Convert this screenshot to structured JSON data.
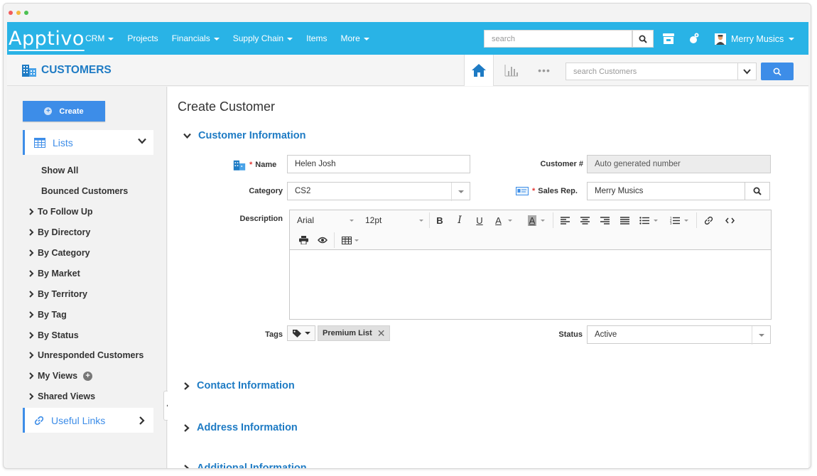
{
  "nav": {
    "logo": "Apptivo",
    "menu": [
      {
        "label": "CRM",
        "dropdown": true
      },
      {
        "label": "Projects",
        "dropdown": false
      },
      {
        "label": "Financials",
        "dropdown": true
      },
      {
        "label": "Supply Chain",
        "dropdown": true
      },
      {
        "label": "Items",
        "dropdown": false
      },
      {
        "label": "More",
        "dropdown": true
      }
    ],
    "search_placeholder": "search",
    "user_name": "Merry Musics",
    "icons": [
      "search-icon",
      "store-icon",
      "user-gear-icon",
      "avatar-icon"
    ]
  },
  "subbar": {
    "title": "CUSTOMERS",
    "search_placeholder": "search Customers",
    "more_glyph": "•••"
  },
  "sidebar": {
    "create_label": "Create",
    "lists_label": "Lists",
    "items": [
      {
        "label": "Show All",
        "arrow": false
      },
      {
        "label": "Bounced Customers",
        "arrow": false
      },
      {
        "label": "To Follow Up",
        "arrow": true
      },
      {
        "label": "By Directory",
        "arrow": true
      },
      {
        "label": "By Category",
        "arrow": true
      },
      {
        "label": "By Market",
        "arrow": true
      },
      {
        "label": "By Territory",
        "arrow": true
      },
      {
        "label": "By Tag",
        "arrow": true
      },
      {
        "label": "By Status",
        "arrow": true
      },
      {
        "label": "Unresponded Customers",
        "arrow": true
      },
      {
        "label": "My Views",
        "arrow": true,
        "plus": true
      },
      {
        "label": "Shared Views",
        "arrow": true
      }
    ],
    "useful_links_label": "Useful Links"
  },
  "form": {
    "page_title": "Create Customer",
    "sections": {
      "customer_info": "Customer Information",
      "contact_info": "Contact Information",
      "address_info": "Address Information",
      "additional_info": "Additional Information"
    },
    "name_label": "Name",
    "name_value": "Helen Josh",
    "customer_no_label": "Customer #",
    "customer_no_value": "Auto generated number",
    "category_label": "Category",
    "category_value": "CS2",
    "sales_rep_label": "Sales Rep.",
    "sales_rep_value": "Merry Musics",
    "description_label": "Description",
    "editor": {
      "font": "Arial",
      "size": "12pt",
      "bold": "B",
      "italic": "I",
      "underline": "U",
      "font_color": "A",
      "highlight": "A"
    },
    "tags_label": "Tags",
    "tag_value": "Premium List",
    "status_label": "Status",
    "status_value": "Active"
  },
  "colors": {
    "navbar": "#29b3e6",
    "accent": "#3d8de8",
    "link": "#1e7bc4",
    "required": "#e53935"
  }
}
